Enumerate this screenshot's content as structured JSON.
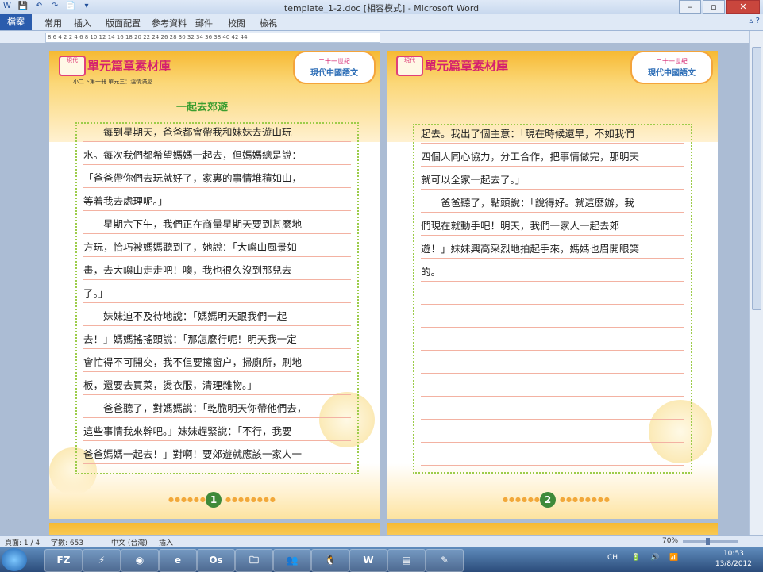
{
  "window": {
    "title": "template_1-2.doc [相容模式] - Microsoft Word",
    "buttons": {
      "minimize": "–",
      "restore": "▫",
      "close": "✕"
    }
  },
  "qat": [
    "W",
    "💾",
    "↶",
    "↷",
    "📄",
    "▾"
  ],
  "tabs": [
    "檔案",
    "常用",
    "插入",
    "版面配置",
    "參考資料",
    "郵件",
    "校閱",
    "檢視"
  ],
  "help": "▵ ?",
  "ruler": {
    "numbers": "8 6 4 2   2 4 6 8 10 12 14 16 18 20 22 24 26 28 30 32 34 36 38 40 42 44"
  },
  "header": {
    "logo": "現代",
    "unit_title": "單元篇章素材庫",
    "badge_line1": "二十一世紀",
    "badge_line2": "現代中國語文"
  },
  "page1": {
    "breadcrumb": "小二下第一冊 單元三：溫情滿屋",
    "story_title": "一起去郊遊",
    "lines": [
      "　　每到星期天，爸爸都會帶我和妹妹去遊山玩",
      "水。每次我們都希望媽媽一起去，但媽媽總是說：",
      "「爸爸帶你們去玩就好了，家裏的事情堆積如山，",
      "等着我去處理呢。」",
      "　　星期六下午，我們正在商量星期天要到甚麼地",
      "方玩，恰巧被媽媽聽到了，她說：「大嶼山風景如",
      "畫，去大嶼山走走吧！噢，我也很久沒到那兒去",
      "了。」",
      "　　妹妹迫不及待地說：「媽媽明天跟我們一起",
      "去！」媽媽搖搖頭說：「那怎麼行呢！明天我一定",
      "會忙得不可開交，我不但要擦窗户，掃廁所，刷地",
      "板，還要去買菜，燙衣服，清理雜物。」",
      "　　爸爸聽了，對媽媽說：「乾脆明天你帶他們去，",
      "這些事情我來幹吧。」妹妹趕緊說：「不行，我要",
      "爸爸媽媽一起去！」對啊！要郊遊就應該一家人一"
    ],
    "page_number": "1"
  },
  "page2": {
    "lines": [
      "起去。我出了個主意：「現在時候還早，不如我們",
      "四個人同心協力，分工合作，把事情做完，那明天",
      "就可以全家一起去了。」",
      "　　爸爸聽了，點頭說：「說得好。就這麼辦，我",
      "們現在就動手吧！明天，我們一家人一起去郊",
      "遊！」妹妹興高采烈地拍起手來，媽媽也眉開眼笑",
      "的。",
      "",
      "",
      "",
      "",
      "",
      "",
      "",
      ""
    ],
    "page_number": "2"
  },
  "status": {
    "page": "頁面: 1 / 4",
    "words": "字數: 653",
    "language": "中文 (台灣)",
    "mode": "插入",
    "zoom": "70%",
    "zoom_fraction": 0.45
  },
  "taskbar": {
    "apps": [
      "FZ",
      "⚡",
      "◉",
      "e",
      "Os",
      "🗀",
      "👥",
      "🐧",
      "W",
      "▤",
      "✎"
    ],
    "tray_icons": [
      "CH",
      "🔋",
      "🔊",
      "📶"
    ],
    "time": "10:53",
    "date": "13/8/2012"
  }
}
